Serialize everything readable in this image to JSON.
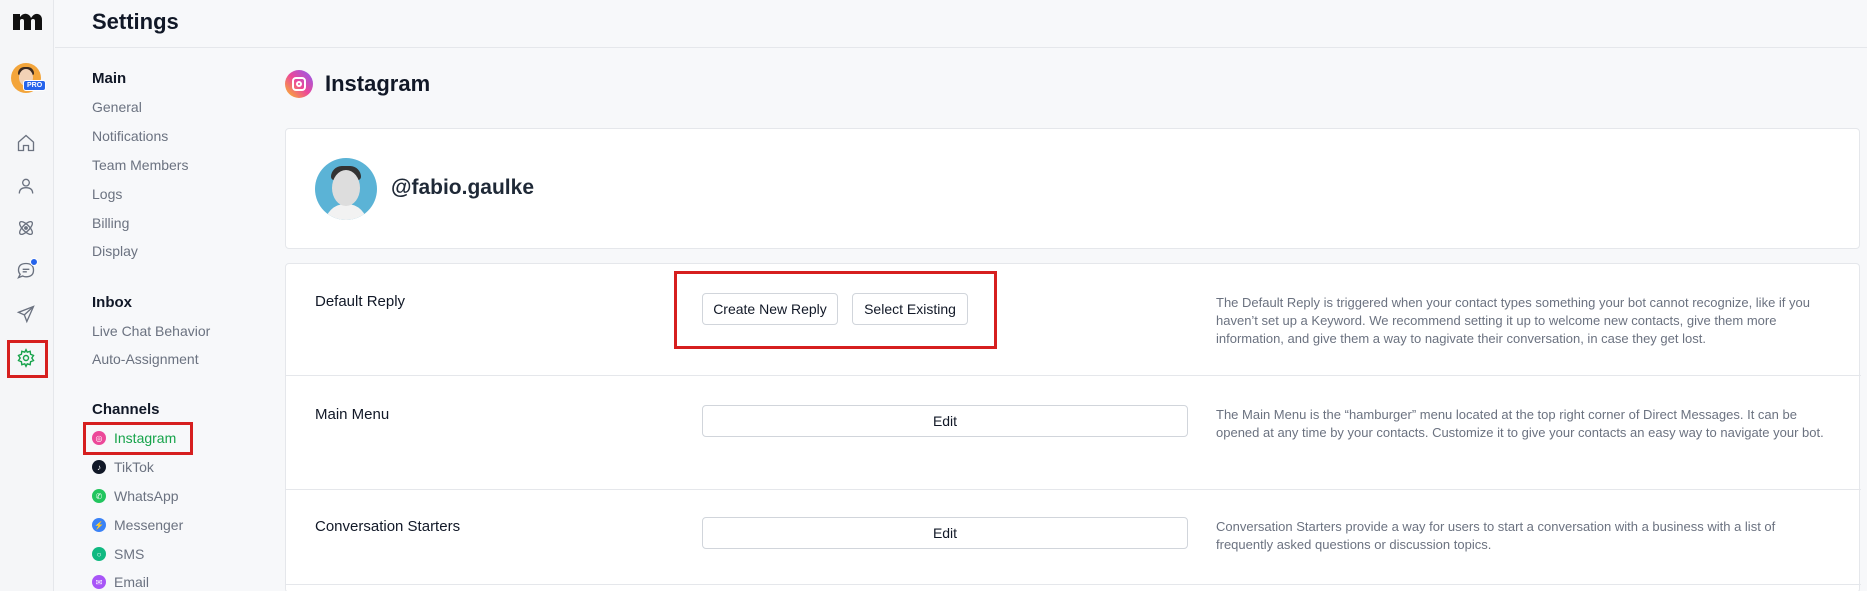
{
  "app": {
    "page_title": "Settings",
    "pro_badge": "PRO"
  },
  "nav": {
    "main_heading": "Main",
    "main_items": [
      "General",
      "Notifications",
      "Team Members",
      "Logs",
      "Billing",
      "Display"
    ],
    "inbox_heading": "Inbox",
    "inbox_items": [
      "Live Chat Behavior",
      "Auto-Assignment"
    ],
    "channels_heading": "Channels",
    "channels": [
      {
        "label": "Instagram",
        "icon": "instagram-icon",
        "color": "#ec4899",
        "active": true
      },
      {
        "label": "TikTok",
        "icon": "tiktok-icon",
        "color": "#111827"
      },
      {
        "label": "WhatsApp",
        "icon": "whatsapp-icon",
        "color": "#22c55e"
      },
      {
        "label": "Messenger",
        "icon": "messenger-icon",
        "color": "#3b82f6"
      },
      {
        "label": "SMS",
        "icon": "sms-icon",
        "color": "#10b981"
      },
      {
        "label": "Email",
        "icon": "email-icon",
        "color": "#a855f7"
      }
    ]
  },
  "main": {
    "section_title": "Instagram",
    "profile_handle": "@fabio.gaulke",
    "rows": [
      {
        "label": "Default Reply",
        "buttons": [
          "Create New Reply",
          "Select Existing"
        ],
        "description": "The Default Reply is triggered when your contact types something your bot cannot recognize, like if you haven’t set up a Keyword. We recommend setting it up to welcome new contacts, give them more information, and give them a way to nagivate their conversation, in case they get lost."
      },
      {
        "label": "Main Menu",
        "buttons": [
          "Edit"
        ],
        "description": "The Main Menu is the “hamburger” menu located at the top right corner of Direct Messages. It can be opened at any time by your contacts. Customize it to give your contacts an easy way to navigate your bot."
      },
      {
        "label": "Conversation Starters",
        "buttons": [
          "Edit"
        ],
        "description": "Conversation Starters provide a way for users to start a conversation with a business with a list of frequently asked questions or discussion topics."
      }
    ]
  },
  "colors": {
    "accent": "#16a34a",
    "highlight": "#d61f1f",
    "badge": "#2563eb"
  }
}
